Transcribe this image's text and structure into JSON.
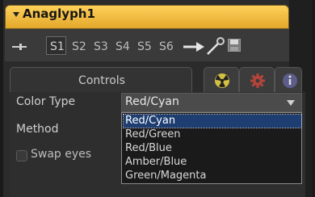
{
  "header": {
    "title": "Anaglyph1"
  },
  "toolbar": {
    "slots": [
      "S1",
      "S2",
      "S3",
      "S4",
      "S5",
      "S6"
    ]
  },
  "tabs": {
    "controls_label": "Controls"
  },
  "controls": {
    "color_type_label": "Color Type",
    "color_type_value": "Red/Cyan",
    "method_label": "Method",
    "swap_eyes_label": "Swap eyes"
  },
  "dropdown": {
    "options": [
      "Red/Cyan",
      "Red/Green",
      "Red/Blue",
      "Amber/Blue",
      "Green/Magenta"
    ],
    "selected_index": 0
  },
  "colors": {
    "header_gold": "#f2c04a",
    "selection_blue": "#1e3e72"
  },
  "icons": {
    "collapse": "triangle-down-icon",
    "pin": "pin-icon",
    "connect": "arrow-right-icon",
    "wand": "wand-icon",
    "save": "save-icon",
    "radio": "radiation-icon",
    "gear": "gear-icon",
    "info": "info-icon"
  }
}
